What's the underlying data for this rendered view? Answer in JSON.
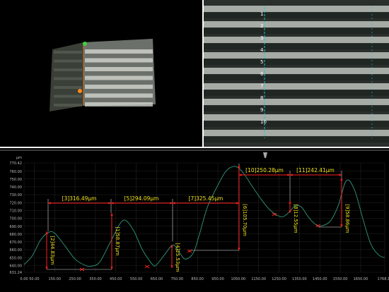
{
  "colors": {
    "background": "#000000",
    "profile_curve": "#2d8a72",
    "measure_line": "#ff2020",
    "measure_text": "#f2e21a",
    "axis_text": "#bfbfbf",
    "scan_line": "#18c8d8"
  },
  "viewer_3d": {
    "marker_top_color": "#3fd23f",
    "marker_mid_color": "#ff8a1a"
  },
  "micrograph": {
    "scan_marks": [
      "1",
      "2",
      "3",
      "4",
      "5",
      "6",
      "7",
      "8",
      "9",
      "10"
    ]
  },
  "profile": {
    "y_ticks": [
      "770.42",
      "760.00",
      "750.00",
      "740.00",
      "730.00",
      "720.00",
      "710.00",
      "700.00",
      "690.00",
      "680.00",
      "670.00",
      "660.00",
      "650.00",
      "640.00",
      "631.24"
    ],
    "x_ticks": [
      "0.00",
      "50.00",
      "150.00",
      "250.00",
      "350.00",
      "450.00",
      "550.00",
      "650.00",
      "750.00",
      "850.00",
      "950.00",
      "1050.00",
      "1150.00",
      "1250.00",
      "1350.00",
      "1450.00",
      "1550.00",
      "1650.00",
      "1768.10"
    ],
    "y_unit_label": "μm"
  },
  "measurements": {
    "m1": "[1]58.87μm",
    "m2": "[2]44.83μm",
    "m3": "[3]316.49μm",
    "m4": "[4]25.53μm",
    "m5": "[5]294.09μm",
    "m6": "[6]105.70μm",
    "m7": "[7]325.45μm",
    "m8": "[8]12.55μm",
    "m9": "[9]58.86μm",
    "m10": "[10]250.28μm",
    "m11": "[11]242.41μm"
  },
  "chart_data": {
    "type": "line",
    "title": "",
    "xlabel": "",
    "ylabel": "",
    "xlim": [
      0,
      1768.1
    ],
    "ylim": [
      631.24,
      770.42
    ],
    "grid": true,
    "series": [
      {
        "x": [
          0,
          40,
          80,
          120,
          150,
          200,
          250,
          300,
          330,
          370,
          420,
          470,
          500,
          540,
          580,
          630,
          650,
          690,
          730,
          760,
          790,
          830,
          860,
          900,
          950,
          990,
          1030,
          1060,
          1090,
          1120,
          1160,
          1200,
          1240,
          1270,
          1300,
          1330,
          1360,
          1390,
          1420,
          1450,
          1500,
          1540,
          1580,
          1620,
          1660,
          1700,
          1740,
          1768
        ],
        "y": [
          641,
          652,
          672,
          682,
          681,
          665,
          648,
          640,
          639,
          644,
          668,
          693,
          697,
          683,
          660,
          641,
          641,
          654,
          666,
          657,
          648,
          656,
          680,
          715,
          742,
          760,
          766,
          762,
          752,
          740,
          725,
          712,
          704,
          702,
          708,
          716,
          714,
          703,
          694,
          690,
          696,
          716,
          748,
          736,
          700,
          667,
          653,
          650
        ]
      }
    ]
  }
}
